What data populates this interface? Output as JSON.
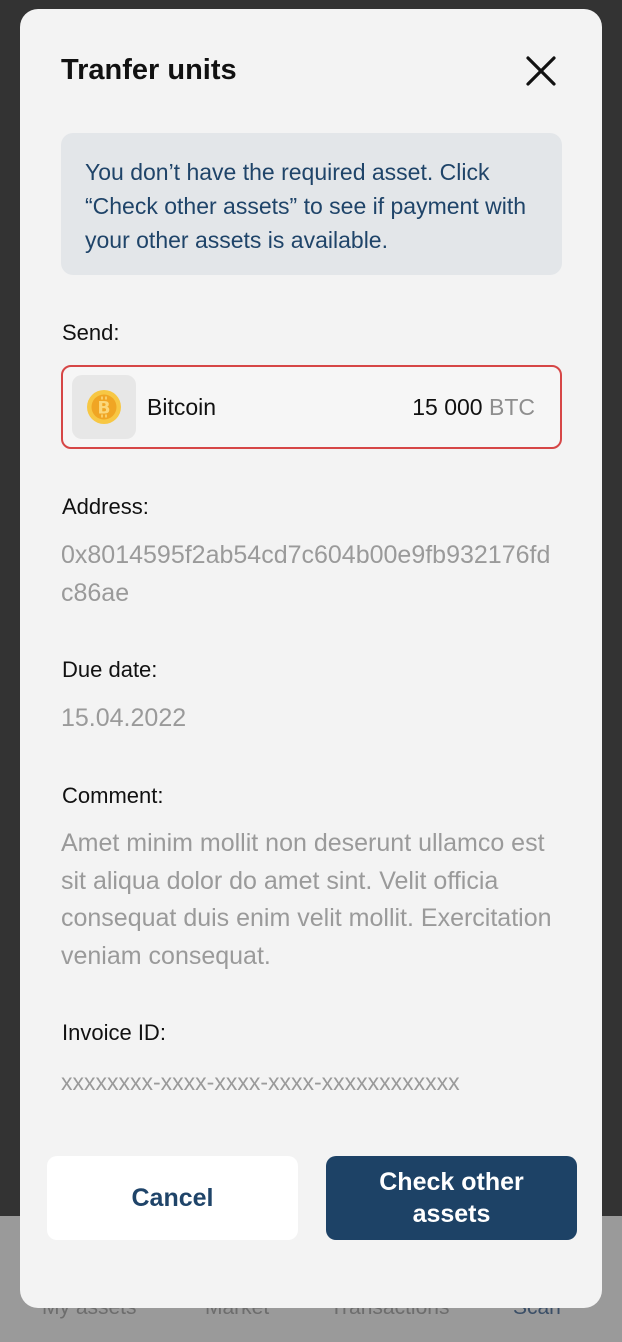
{
  "background_nav": {
    "items": [
      "My assets",
      "Market",
      "Transactions",
      "Scan"
    ]
  },
  "modal": {
    "title": "Tranfer units",
    "close_icon": "close-icon",
    "notice": "You don’t have the required asset. Click “Check other assets” to see if payment with your other assets is available.",
    "send": {
      "label": "Send:",
      "asset_name": "Bitcoin",
      "amount": "15 000",
      "unit": "BTC",
      "icon": "bitcoin-icon"
    },
    "address": {
      "label": "Address:",
      "value": "0x8014595f2ab54cd7c604b00e9fb932176fdc86ae"
    },
    "due_date": {
      "label": "Due date:",
      "value": "15.04.2022"
    },
    "comment": {
      "label": "Comment:",
      "value": "Amet minim mollit non deserunt ullamco est sit aliqua dolor do amet sint. Velit officia consequat duis enim velit mollit. Exercitation veniam consequat."
    },
    "invoice_id": {
      "label": "Invoice ID:",
      "value": "xxxxxxxx-xxxx-xxxx-xxxx-xxxxxxxxxxxx"
    },
    "buttons": {
      "cancel": "Cancel",
      "check_other": "Check other assets"
    }
  },
  "colors": {
    "accent": "#1d4266",
    "error_border": "#d64646",
    "notice_bg": "#e3e6e9",
    "muted_text": "#9a9a9a"
  }
}
